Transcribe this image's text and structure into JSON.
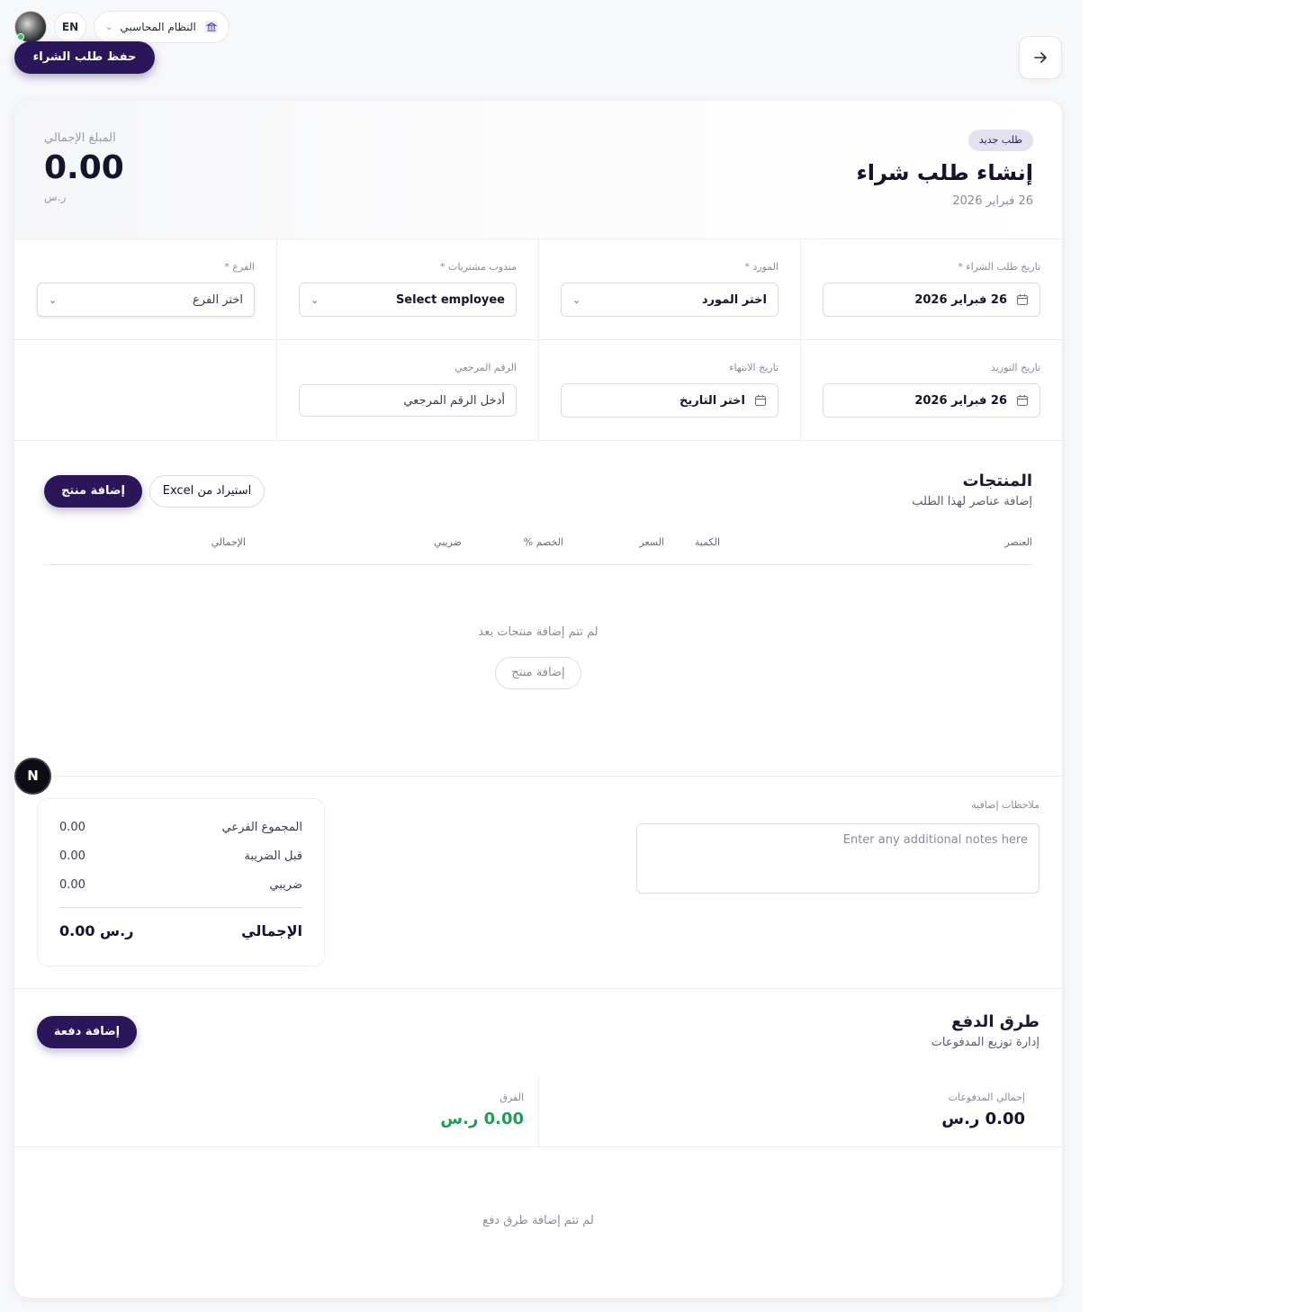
{
  "topbar": {
    "lang": "EN",
    "system": "النظام المحاسبي",
    "save": "حفظ طلب الشراء"
  },
  "header": {
    "badge": "طلب جديد",
    "title": "إنشاء طلب شراء",
    "date": "26 فبراير 2026",
    "total_label": "المبلغ الإجمالي",
    "total_value": "0.00",
    "currency": "ر.س"
  },
  "form": {
    "order_date": {
      "label": "تاريخ طلب الشراء *",
      "value": "26 فبراير 2026"
    },
    "supplier": {
      "label": "المورد *",
      "value": "اختر المورد"
    },
    "purchaser": {
      "label": "مندوب مشتريات *",
      "value": "Select employee"
    },
    "branch": {
      "label": "الفرع *",
      "value": "اختر الفرع"
    },
    "delivery_date": {
      "label": "تاريخ التوريد",
      "value": "26 فبراير 2026"
    },
    "expiry_date": {
      "label": "تاريخ الانتهاء",
      "value": "اختر التاريخ"
    },
    "reference": {
      "label": "الرقم المرجعي",
      "placeholder": "أدخل الرقم المرجعي"
    }
  },
  "products": {
    "title": "المنتجات",
    "subtitle": "إضافة عناصر لهذا الطلب",
    "add_button": "إضافة منتج",
    "import_button": "استيراد من Excel",
    "columns": {
      "item": "العنصر",
      "qty": "الكمية",
      "price": "السعر",
      "discount": "الخصم %",
      "tax": "ضريبي",
      "total": "الإجمالي"
    },
    "empty_text": "لم تتم إضافة منتجات بعد",
    "empty_button": "إضافة منتج"
  },
  "notes": {
    "label": "ملاحظات إضافية",
    "placeholder": "Enter any additional notes here"
  },
  "summary": {
    "subtotal_label": "المجموع الفرعي",
    "subtotal": "0.00",
    "pretax_label": "قبل الضريبة",
    "pretax": "0.00",
    "tax_label": "ضريبي",
    "tax": "0.00",
    "total_label": "الإجمالي",
    "total": "0.00 ر.س"
  },
  "payments": {
    "title": "طرق الدفع",
    "subtitle": "إدارة توزيع المدفوعات",
    "add_button": "إضافة دفعة",
    "paid_label": "إجمالي المدفوعات",
    "paid_value": "0.00 ر.س",
    "diff_label": "الفرق",
    "diff_value": "0.00 ر.س",
    "empty_text": "لم تتم إضافة طرق دفع"
  },
  "fab": "N",
  "colors": {
    "primary": "#2b1659",
    "success": "#1f9d55",
    "badge_bg": "#e3e1ef"
  }
}
